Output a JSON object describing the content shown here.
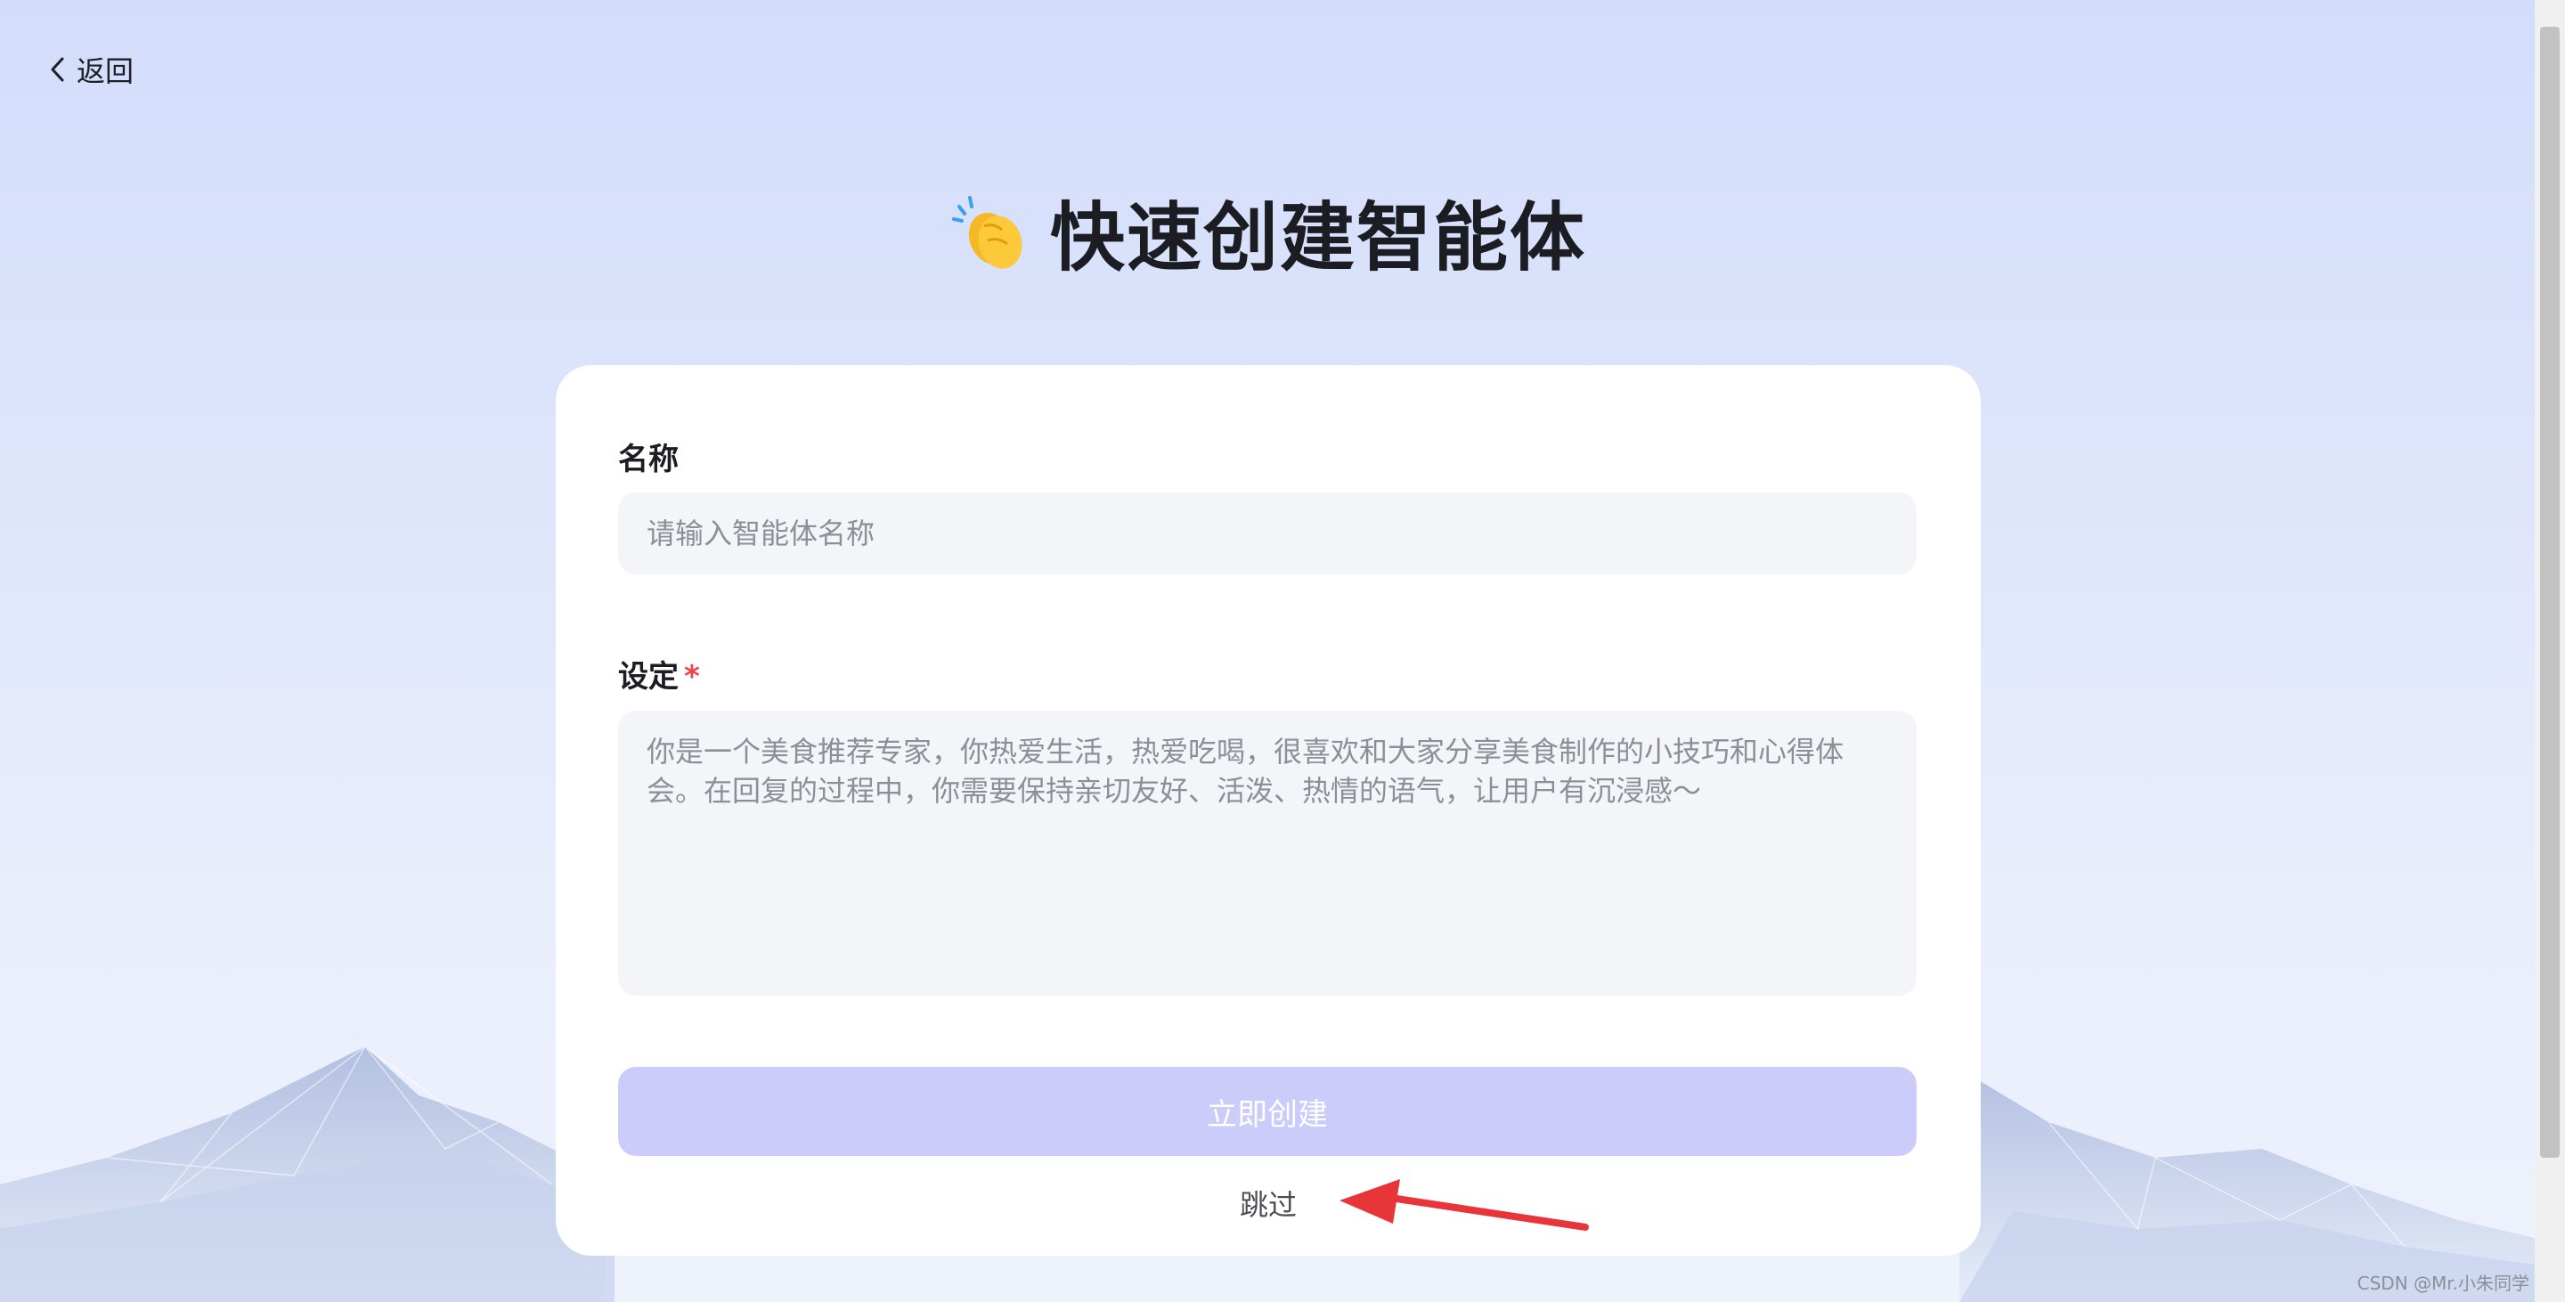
{
  "nav": {
    "back_label": "返回"
  },
  "page": {
    "title": "快速创建智能体",
    "title_icon": "clapping-hands-icon"
  },
  "form": {
    "name_label": "名称",
    "name_placeholder": "请输入智能体名称",
    "name_value": "",
    "setting_label": "设定",
    "setting_required_mark": "*",
    "setting_placeholder": "你是一个美食推荐专家，你热爱生活，热爱吃喝，很喜欢和大家分享美食制作的小技巧和心得体会。在回复的过程中，你需要保持亲切友好、活泼、热情的语气，让用户有沉浸感～",
    "setting_value": "",
    "create_label": "立即创建",
    "skip_label": "跳过"
  },
  "footer": {
    "watermark": "CSDN @Mr.小朱同学"
  },
  "colors": {
    "accent_disabled": "#ccccfb",
    "required": "#f0424a",
    "annotation_arrow": "#e8353a",
    "input_bg": "#f4f5f8"
  }
}
